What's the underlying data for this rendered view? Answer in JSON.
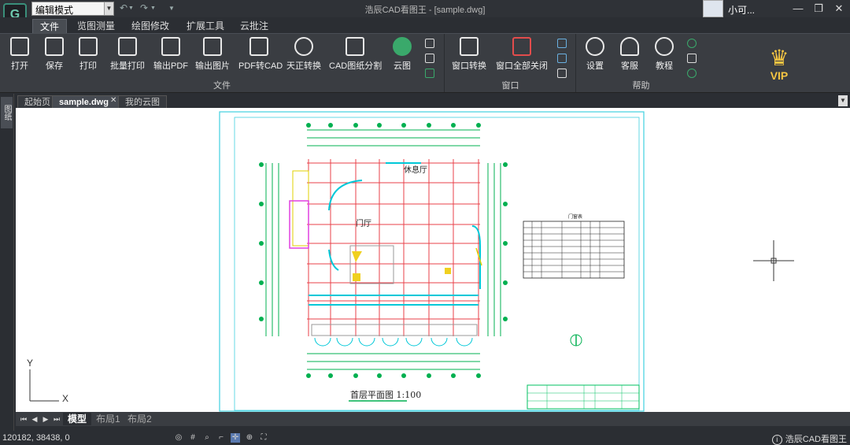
{
  "titlebar": {
    "mode": "编辑模式",
    "title": "浩辰CAD看图王 - [sample.dwg]",
    "user": "小可..."
  },
  "menu": {
    "tabs": [
      "文件",
      "览图测量",
      "绘图修改",
      "扩展工具",
      "云批注"
    ]
  },
  "ribbon": {
    "file_group_label": "文件",
    "window_group_label": "窗口",
    "help_group_label": "帮助",
    "file_tools": [
      "打开",
      "保存",
      "打印",
      "批量打印",
      "输出PDF",
      "输出图片",
      "PDF转CAD",
      "天正转换",
      "CAD图纸分割",
      "云图"
    ],
    "window_tools": [
      "窗口转换",
      "窗口全部关闭"
    ],
    "help_tools": [
      "设置",
      "客服",
      "教程"
    ],
    "vip": "VIP"
  },
  "doctabs": {
    "side_tab": "图纸",
    "tabs": [
      "起始页",
      "sample.dwg",
      "我的云图"
    ]
  },
  "drawing": {
    "title": "首层平面图 1:100",
    "room_lounge": "休息厅",
    "room_hall": "门厅",
    "table_title": "门窗表",
    "ucs_y": "Y",
    "ucs_x": "X"
  },
  "layouts": {
    "tabs": [
      "模型",
      "布局1",
      "布局2"
    ]
  },
  "status": {
    "coords": "120182, 38438, 0",
    "brand": "浩辰CAD看图王"
  },
  "colors": {
    "accent": "#3a8f7a",
    "grid_red": "#e8404a",
    "drawing_green": "#00c060",
    "drawing_cyan": "#00c8d8",
    "frame_cyan": "#40d0e0"
  }
}
